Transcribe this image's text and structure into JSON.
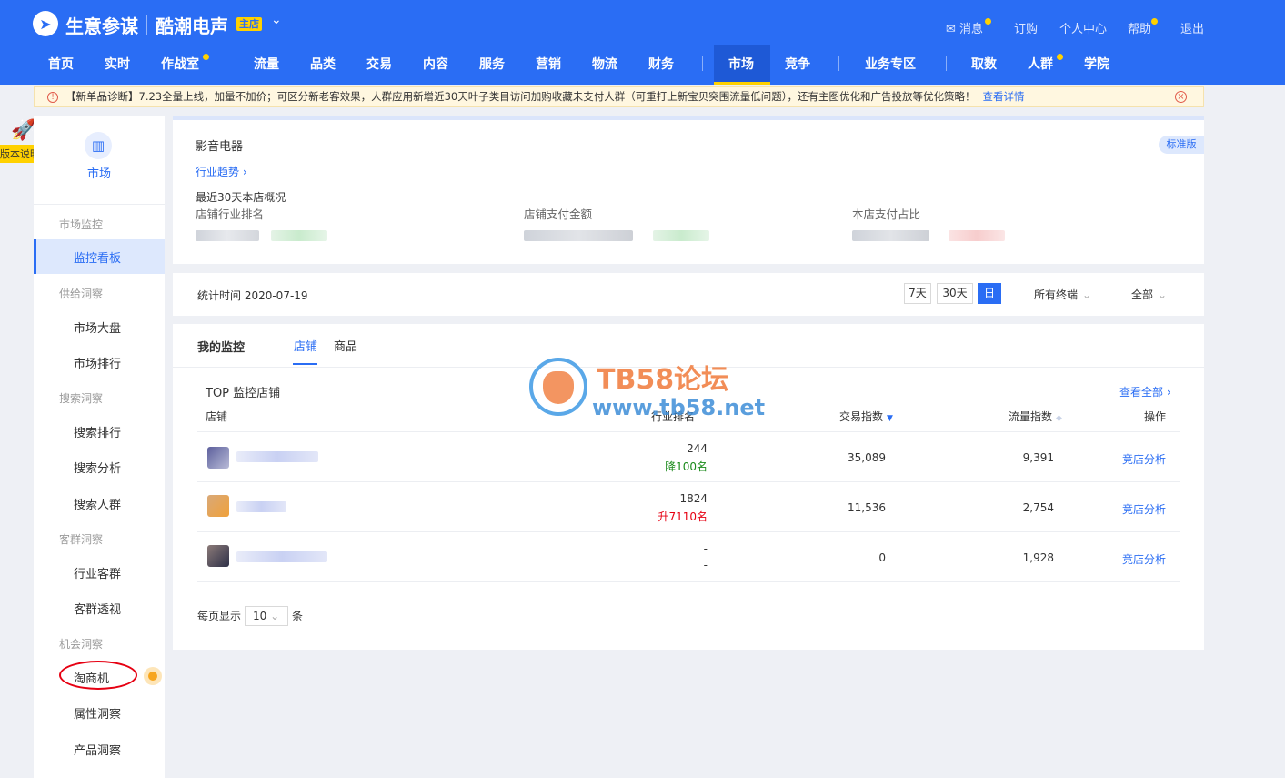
{
  "header": {
    "brand": "生意参谋",
    "shop_name": "酷潮电声",
    "shop_badge": "主店",
    "links": {
      "message": "消息",
      "order": "订购",
      "personal": "个人中心",
      "help": "帮助",
      "logout": "退出"
    },
    "nav": [
      "首页",
      "实时",
      "作战室",
      "流量",
      "品类",
      "交易",
      "内容",
      "服务",
      "营销",
      "物流",
      "财务",
      "市场",
      "竞争",
      "业务专区",
      "取数",
      "人群",
      "学院"
    ],
    "active_nav": "市场",
    "brand_color": "#2a6df4"
  },
  "notice": {
    "text": "【新单品诊断】7.23全量上线，加量不加价；可区分新老客效果，人群应用新增近30天叶子类目访问加购收藏未支付人群（可重打上新宝贝突围流量低问题），还有主图优化和广告投放等优化策略！",
    "link": "查看详情"
  },
  "version_tag": "版本说明",
  "sidebar": {
    "top_label": "市场",
    "groups": [
      {
        "title": "市场监控",
        "items": [
          "监控看板"
        ]
      },
      {
        "title": "供给洞察",
        "items": [
          "市场大盘",
          "市场排行"
        ]
      },
      {
        "title": "搜索洞察",
        "items": [
          "搜索排行",
          "搜索分析",
          "搜索人群"
        ]
      },
      {
        "title": "客群洞察",
        "items": [
          "行业客群",
          "客群透视"
        ]
      },
      {
        "title": "机会洞察",
        "items": [
          "淘商机",
          "属性洞察",
          "产品洞察"
        ]
      }
    ],
    "active_item": "监控看板"
  },
  "overview": {
    "category": "影音电器",
    "trend_link": "行业趋势",
    "recent": "最近30天本店概况",
    "metrics": [
      "店铺行业排名",
      "店铺支付金额",
      "本店支付占比"
    ],
    "edition": "标准版"
  },
  "filters": {
    "stat_time": "统计时间 2020-07-19",
    "ranges": [
      "7天",
      "30天",
      "日"
    ],
    "active_range": "日",
    "terminal": "所有终端",
    "scope": "全部"
  },
  "monitor": {
    "title": "我的监控",
    "tabs": [
      "店铺",
      "商品"
    ],
    "active_tab": "店铺",
    "table_title": "TOP 监控店铺",
    "view_all": "查看全部",
    "columns": [
      "店铺",
      "行业排名",
      "交易指数",
      "流量指数",
      "操作"
    ],
    "rows": [
      {
        "rank": "244",
        "rank_change": "降100名",
        "trade_index": "35,089",
        "traffic_index": "9,391",
        "action": "竞店分析"
      },
      {
        "rank": "1824",
        "rank_change": "升7110名",
        "trade_index": "11,536",
        "traffic_index": "2,754",
        "action": "竞店分析"
      },
      {
        "rank": "-",
        "rank_change": "-",
        "trade_index": "0",
        "traffic_index": "1,928",
        "action": "竞店分析"
      }
    ],
    "pager": {
      "prefix": "每页显示",
      "value": "10",
      "suffix": "条"
    }
  },
  "watermark": {
    "title": "TB58论坛",
    "url": "www.tb58.net"
  }
}
